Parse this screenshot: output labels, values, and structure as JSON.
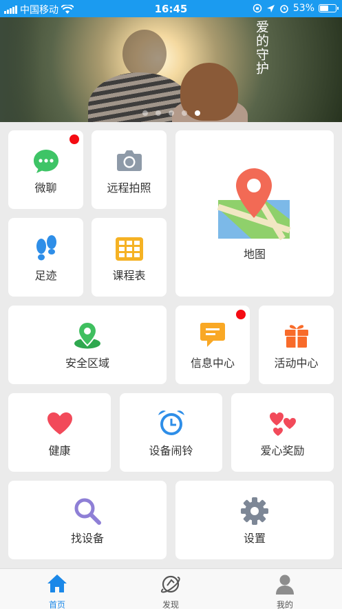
{
  "status_bar": {
    "carrier": "中国移动",
    "time": "16:45",
    "battery": "53%",
    "battery_level": 0.53
  },
  "banner": {
    "caption": "爱的守护",
    "slide_count": 5,
    "active_slide": 5
  },
  "tiles": {
    "chat": "微聊",
    "remote_photo": "远程拍照",
    "map": "地图",
    "footprints": "足迹",
    "schedule": "课程表",
    "safe_zone": "安全区域",
    "messages": "信息中心",
    "activities": "活动中心",
    "health": "健康",
    "alarm": "设备闹铃",
    "rewards": "爱心奖励",
    "find_device": "找设备",
    "settings": "设置"
  },
  "tabbar": {
    "home": "首页",
    "discover": "发现",
    "mine": "我的"
  },
  "colors": {
    "accent": "#1b9bf0",
    "badge": "#f40b12"
  }
}
